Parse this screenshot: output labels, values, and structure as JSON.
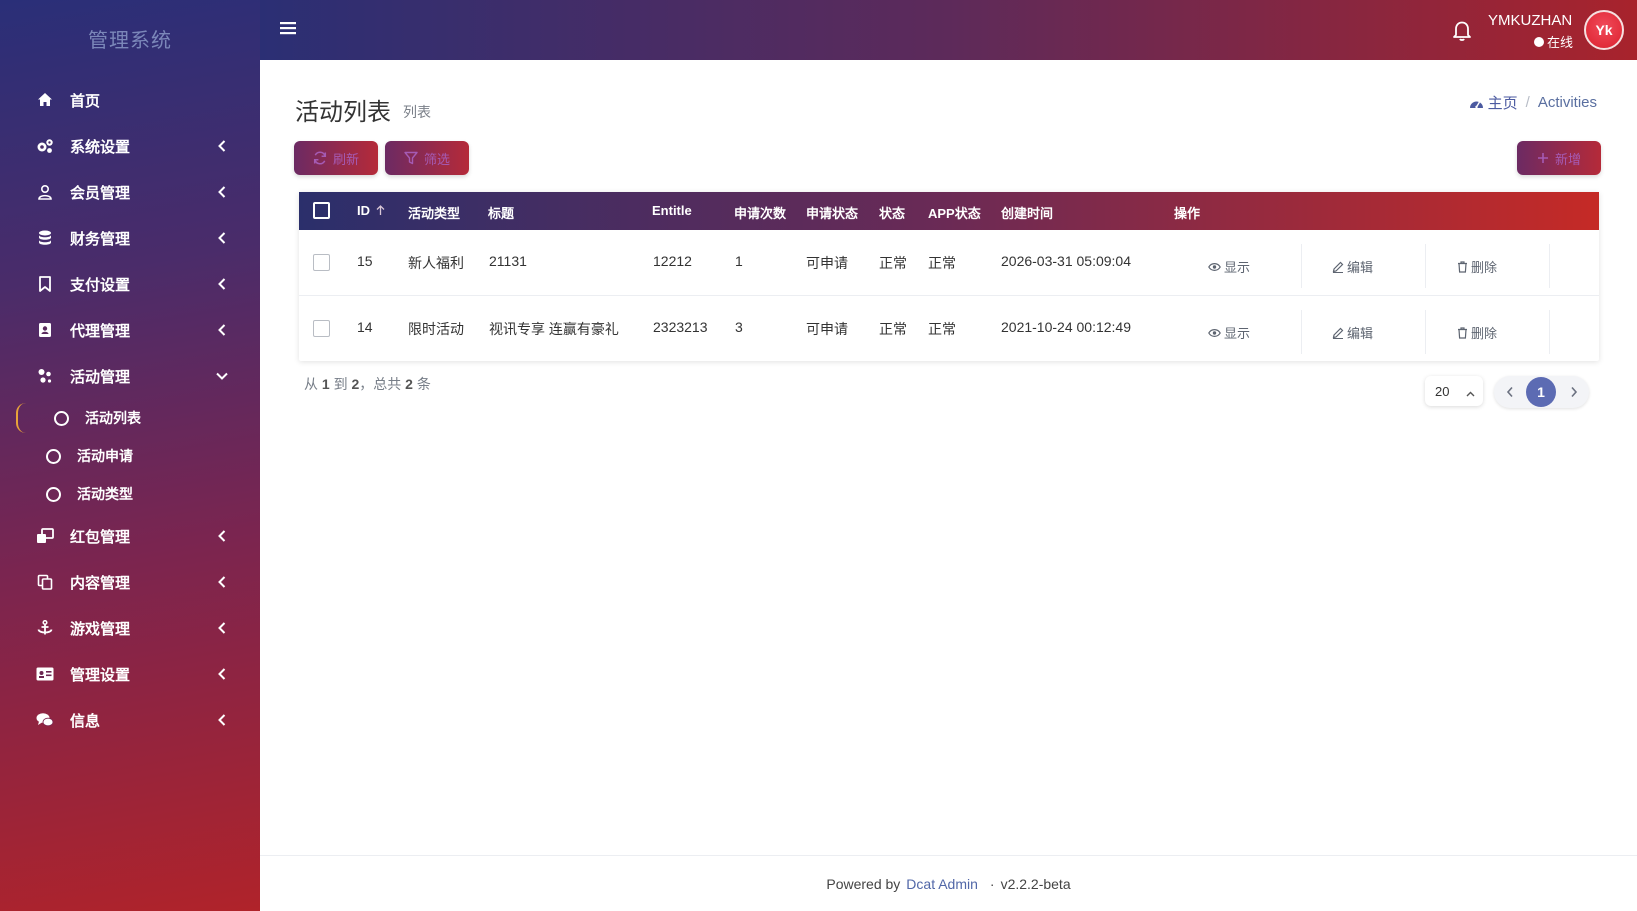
{
  "sidebar": {
    "brand": "管理系统",
    "items": [
      {
        "label": "首页",
        "icon": "home-icon"
      },
      {
        "label": "系统设置",
        "icon": "gears-icon"
      },
      {
        "label": "会员管理",
        "icon": "user-icon"
      },
      {
        "label": "财务管理",
        "icon": "database-icon"
      },
      {
        "label": "支付设置",
        "icon": "bookmark-icon"
      },
      {
        "label": "代理管理",
        "icon": "contact-icon"
      },
      {
        "label": "活动管理",
        "icon": "cogs-icon"
      },
      {
        "label": "红包管理",
        "icon": "window-icon"
      },
      {
        "label": "内容管理",
        "icon": "copy-icon"
      },
      {
        "label": "游戏管理",
        "icon": "anchor-icon"
      },
      {
        "label": "管理设置",
        "icon": "id-card-icon"
      },
      {
        "label": "信息",
        "icon": "comments-icon"
      }
    ],
    "sub_items": [
      {
        "label": "活动列表",
        "active": true
      },
      {
        "label": "活动申请",
        "active": false
      },
      {
        "label": "活动类型",
        "active": false
      }
    ]
  },
  "topbar": {
    "username": "YMKUZHAN",
    "status": "在线",
    "avatar_text": "Yk"
  },
  "page": {
    "title": "活动列表",
    "subtitle": "列表",
    "breadcrumb": {
      "home": "主页",
      "current": "Activities"
    }
  },
  "toolbar": {
    "refresh": "刷新",
    "filter": "筛选",
    "add": "新增"
  },
  "table": {
    "columns": [
      "ID",
      "活动类型",
      "标题",
      "Entitle",
      "申请次数",
      "申请状态",
      "状态",
      "APP状态",
      "创建时间",
      "操作"
    ],
    "rows": [
      {
        "id": "15",
        "type": "新人福利",
        "title": "21131",
        "entitle": "12212",
        "count": "1",
        "apply_status": "可申请",
        "status": "正常",
        "app_status": "正常",
        "created": "2026-03-31 05:09:04"
      },
      {
        "id": "14",
        "type": "限时活动",
        "title": "视讯专享 连赢有豪礼",
        "entitle": "2323213",
        "count": "3",
        "apply_status": "可申请",
        "status": "正常",
        "app_status": "正常",
        "created": "2021-10-24 00:12:49"
      }
    ],
    "actions": {
      "show": "显示",
      "edit": "编辑",
      "delete": "删除"
    }
  },
  "pagination": {
    "prefix": "从",
    "from": "1",
    "to_word": "到",
    "to": "2",
    "total_word": "，总共",
    "total": "2",
    "suffix": "条",
    "per_page": "20",
    "current_page": "1"
  },
  "footer": {
    "powered_by": "Powered by",
    "link": "Dcat Admin",
    "separator": "·",
    "version": "v2.2.2-beta"
  },
  "colors": {
    "sidebar_top": "#2a2f78",
    "sidebar_bottom": "#b0232a",
    "accent_blue": "#5c6bb3",
    "accent_red": "#c52a26"
  }
}
